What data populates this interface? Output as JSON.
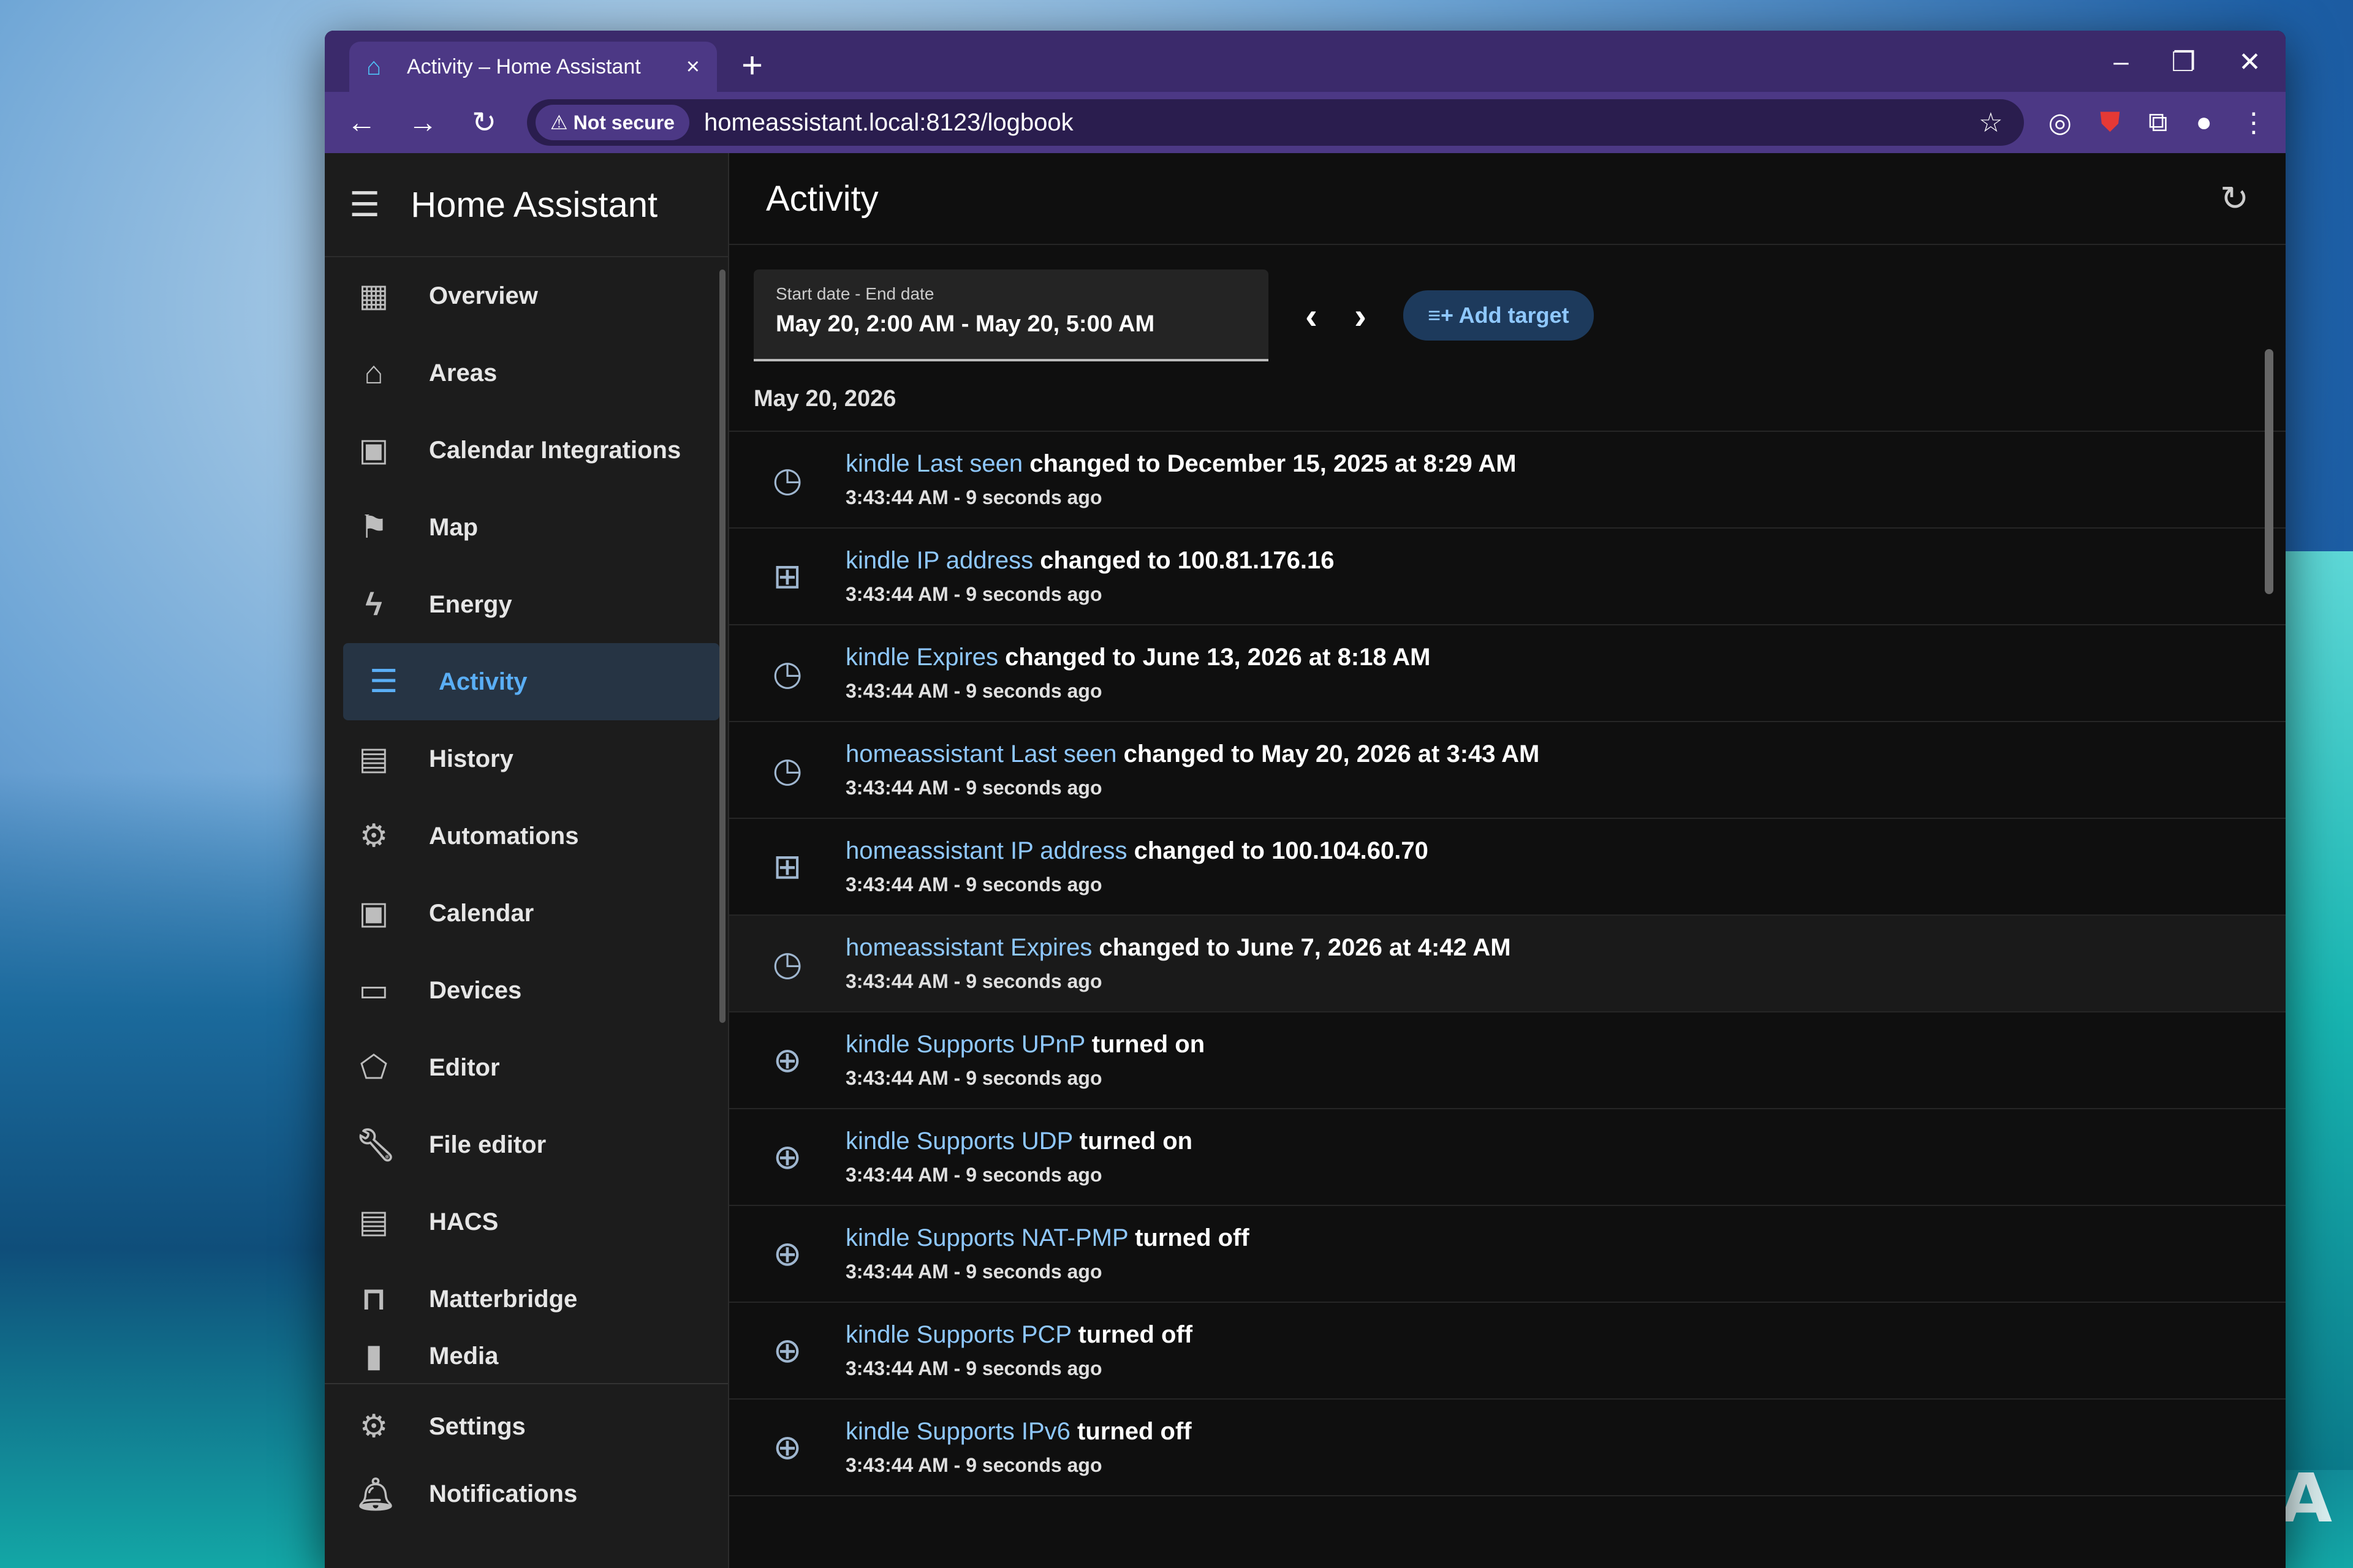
{
  "browser": {
    "tab_title": "Activity – Home Assistant",
    "tab_close": "×",
    "new_tab": "+",
    "security_label": "Not secure",
    "url": "homeassistant.local:8123/logbook",
    "window_controls": [
      "–",
      "❐",
      "✕"
    ]
  },
  "sidebar": {
    "title": "Home Assistant",
    "items": [
      {
        "label": "Overview",
        "icon": "dashboard-icon"
      },
      {
        "label": "Areas",
        "icon": "home-icon"
      },
      {
        "label": "Calendar Integrations",
        "icon": "calendar-icon"
      },
      {
        "label": "Map",
        "icon": "map-icon"
      },
      {
        "label": "Energy",
        "icon": "lightning-icon"
      },
      {
        "label": "Activity",
        "icon": "list-icon",
        "active": true
      },
      {
        "label": "History",
        "icon": "chart-icon"
      },
      {
        "label": "Automations",
        "icon": "robot-icon"
      },
      {
        "label": "Calendar",
        "icon": "calendar-icon"
      },
      {
        "label": "Devices",
        "icon": "devices-icon"
      },
      {
        "label": "Editor",
        "icon": "home-edit-icon"
      },
      {
        "label": "File editor",
        "icon": "wrench-icon"
      },
      {
        "label": "HACS",
        "icon": "hacs-icon"
      },
      {
        "label": "Matterbridge",
        "icon": "bridge-icon"
      },
      {
        "label": "Media",
        "icon": "media-icon"
      }
    ],
    "bottom_items": [
      {
        "label": "Settings",
        "icon": "gear-icon"
      },
      {
        "label": "Notifications",
        "icon": "bell-icon"
      }
    ]
  },
  "main": {
    "title": "Activity",
    "date_range": {
      "label": "Start date - End date",
      "value": "May 20, 2:00 AM - May 20, 5:00 AM"
    },
    "add_target_label": "Add target",
    "day_heading": "May 20, 2026",
    "entries": [
      {
        "entity": "kindle Last seen",
        "message": "changed to December 15, 2025 at 8:29 AM",
        "time": "3:43:44 AM - 9 seconds ago",
        "icon": "clock-icon"
      },
      {
        "entity": "kindle IP address",
        "message": "changed to 100.81.176.16",
        "time": "3:43:44 AM - 9 seconds ago",
        "icon": "ip-network-icon"
      },
      {
        "entity": "kindle Expires",
        "message": "changed to June 13, 2026 at 8:18 AM",
        "time": "3:43:44 AM - 9 seconds ago",
        "icon": "clock-icon"
      },
      {
        "entity": "homeassistant Last seen",
        "message": "changed to May 20, 2026 at 3:43 AM",
        "time": "3:43:44 AM - 9 seconds ago",
        "icon": "clock-icon"
      },
      {
        "entity": "homeassistant IP address",
        "message": "changed to 100.104.60.70",
        "time": "3:43:44 AM - 9 seconds ago",
        "icon": "ip-network-icon"
      },
      {
        "entity": "homeassistant Expires",
        "message": "changed to June 7, 2026 at 4:42 AM",
        "time": "3:43:44 AM - 9 seconds ago",
        "icon": "clock-icon"
      },
      {
        "entity": "kindle Supports UPnP",
        "message": "turned on",
        "time": "3:43:44 AM - 9 seconds ago",
        "icon": "web-icon"
      },
      {
        "entity": "kindle Supports UDP",
        "message": "turned on",
        "time": "3:43:44 AM - 9 seconds ago",
        "icon": "web-icon"
      },
      {
        "entity": "kindle Supports NAT-PMP",
        "message": "turned off",
        "time": "3:43:44 AM - 9 seconds ago",
        "icon": "web-icon"
      },
      {
        "entity": "kindle Supports PCP",
        "message": "turned off",
        "time": "3:43:44 AM - 9 seconds ago",
        "icon": "web-icon"
      },
      {
        "entity": "kindle Supports IPv6",
        "message": "turned off",
        "time": "3:43:44 AM - 9 seconds ago",
        "icon": "web-icon"
      }
    ]
  },
  "watermark": "XDA"
}
